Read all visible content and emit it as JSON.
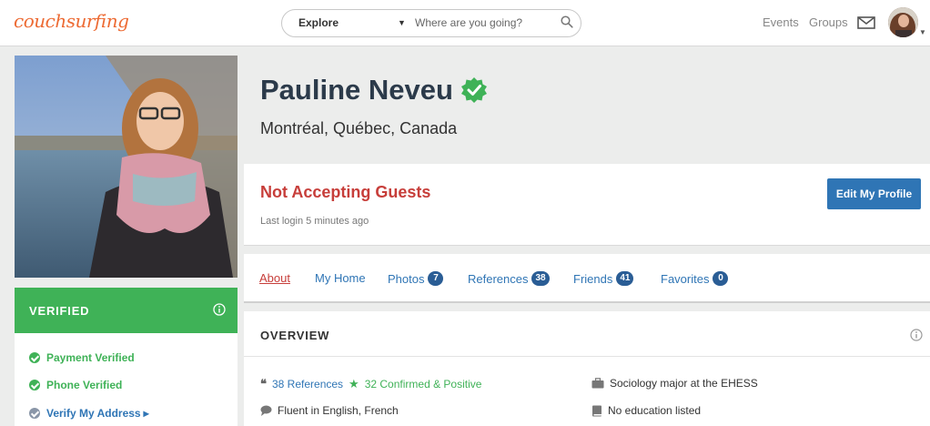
{
  "header": {
    "logo": "couchsurfing",
    "explore_label": "Explore",
    "search_placeholder": "Where are you going?",
    "nav": {
      "events": "Events",
      "groups": "Groups"
    }
  },
  "profile": {
    "name": "Pauline Neveu",
    "location": "Montréal, Québec, Canada",
    "status": "Not Accepting Guests",
    "last_login": "Last login 5 minutes ago",
    "edit_button": "Edit My Profile"
  },
  "tabs": [
    {
      "label": "About",
      "count": null,
      "active": true
    },
    {
      "label": "My Home",
      "count": null
    },
    {
      "label": "Photos",
      "count": "7"
    },
    {
      "label": "References",
      "count": "38"
    },
    {
      "label": "Friends",
      "count": "41"
    },
    {
      "label": "Favorites",
      "count": "0"
    }
  ],
  "verified": {
    "title": "VERIFIED",
    "items": [
      {
        "label": "Payment Verified"
      },
      {
        "label": "Phone Verified"
      },
      {
        "label": "Verify My Address",
        "arrow": "▸"
      }
    ]
  },
  "overview": {
    "title": "OVERVIEW",
    "references": "38 References",
    "confirmed": "32 Confirmed & Positive",
    "languages": "Fluent in English, French",
    "occupation": "Sociology major at the EHESS",
    "education": "No education listed"
  },
  "colors": {
    "accent_orange": "#ed6b34",
    "verified_green": "#3fb257",
    "link_blue": "#2f75b5",
    "badge_blue": "#2a5d95",
    "status_red": "#c73e3a"
  }
}
